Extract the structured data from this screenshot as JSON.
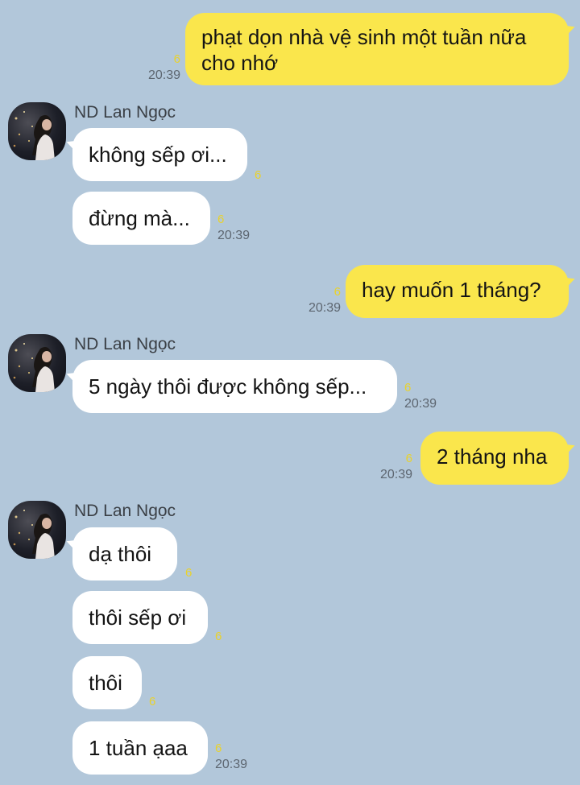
{
  "contact_name": "ND Lan Ngọc",
  "messages": [
    {
      "dir": "out",
      "text_line1": "phạt dọn nhà vệ sinh một tuần nữa",
      "text_line2": "cho nhớ",
      "unread": "6",
      "time": "20:39"
    },
    {
      "dir": "in",
      "text": "không sếp ơi...",
      "unread": "6"
    },
    {
      "dir": "in",
      "text": "đừng mà...",
      "unread": "6",
      "time": "20:39"
    },
    {
      "dir": "out",
      "text": "hay muốn 1 tháng?",
      "unread": "6",
      "time": "20:39"
    },
    {
      "dir": "in",
      "text": "5 ngày thôi được không sếp...",
      "unread": "6",
      "time": "20:39"
    },
    {
      "dir": "out",
      "text": "2 tháng nha",
      "unread": "6",
      "time": "20:39"
    },
    {
      "dir": "in",
      "text": "dạ thôi",
      "unread": "6"
    },
    {
      "dir": "in",
      "text": "thôi sếp ơi",
      "unread": "6"
    },
    {
      "dir": "in",
      "text": "thôi",
      "unread": "6"
    },
    {
      "dir": "in",
      "text": "1 tuần ạaa",
      "unread": "6",
      "time": "20:39"
    }
  ],
  "colors": {
    "background": "#b2c7da",
    "outgoing_bubble": "#fae64c",
    "incoming_bubble": "#ffffff",
    "unread_count": "#e9d22c"
  }
}
